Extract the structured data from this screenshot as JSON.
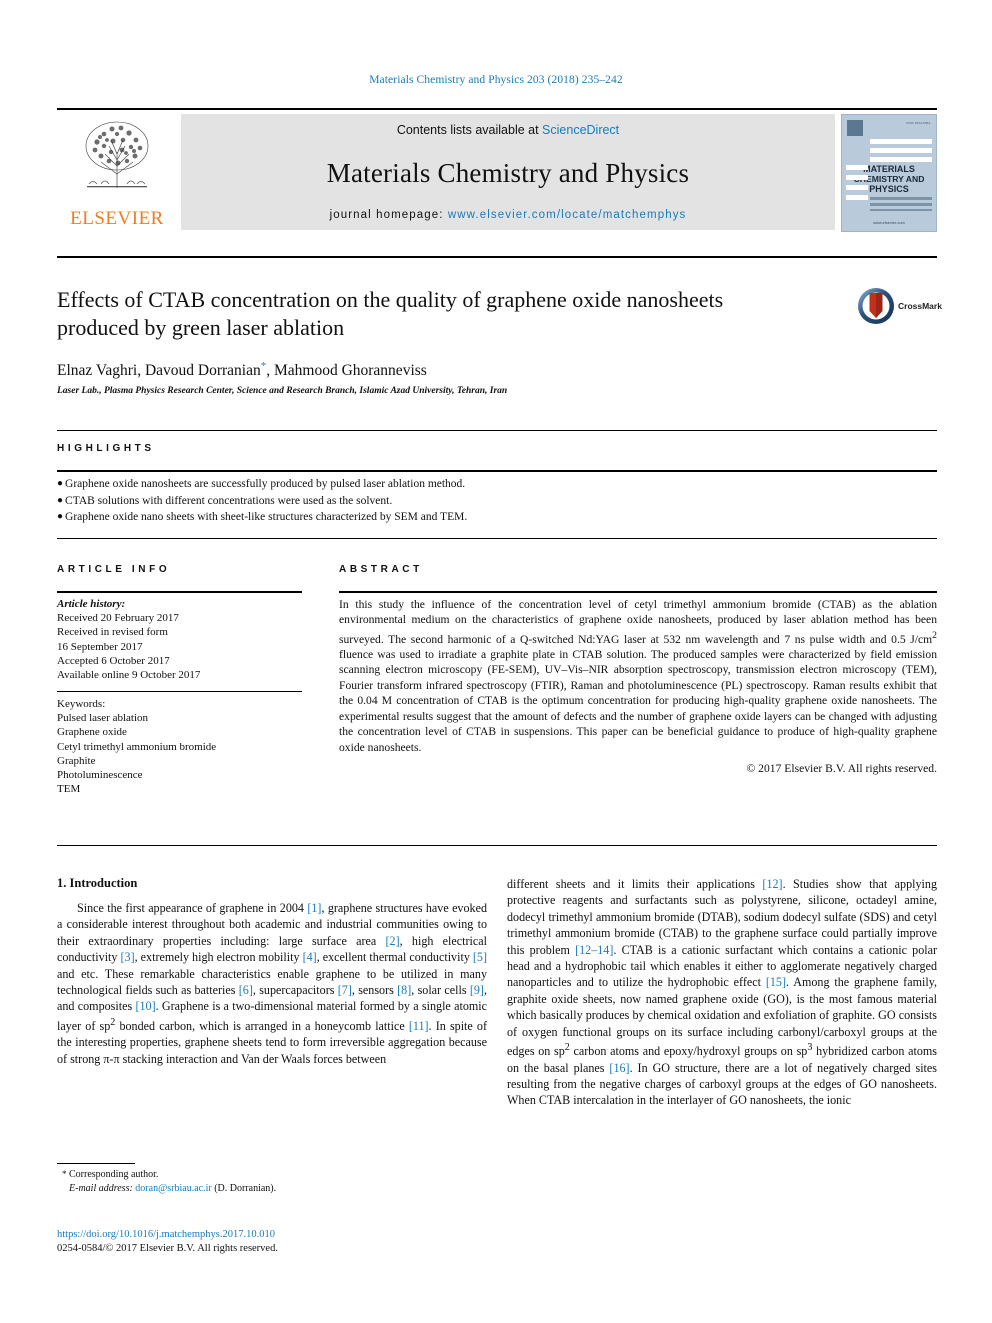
{
  "running_head": "Materials Chemistry and Physics 203 (2018) 235–242",
  "masthead": {
    "publisher_name": "ELSEVIER",
    "contents_prefix": "Contents lists available at ",
    "contents_link": "ScienceDirect",
    "journal_title": "Materials Chemistry and Physics",
    "homepage_prefix": "journal homepage: ",
    "homepage_url": "www.elsevier.com/locate/matchemphys",
    "cover": {
      "line1": "MATERIALS",
      "line2": "CHEMISTRY AND",
      "line3": "PHYSICS",
      "sub1": "MATERIALS",
      "sub2": "SCIENCE AND",
      "sub3": "ENGINEERING"
    },
    "link_color": "#1a7bb9",
    "band_color": "#e3e3e3"
  },
  "article": {
    "title": "Effects of CTAB concentration on the quality of graphene oxide nanosheets produced by green laser ablation",
    "crossmark_label": "CrossMark",
    "authors": "Elnaz Vaghri, Davoud Dorranian",
    "authors_tail": ", Mahmood Ghoranneviss",
    "corresponding_marker": "*",
    "affiliation": "Laser Lab., Plasma Physics Research Center, Science and Research Branch, Islamic Azad University, Tehran, Iran"
  },
  "highlights": {
    "heading": "HIGHLIGHTS",
    "items": [
      "Graphene oxide nanosheets are successfully produced by pulsed laser ablation method.",
      "CTAB solutions with different concentrations were used as the solvent.",
      "Graphene oxide nano sheets with sheet-like structures characterized by SEM and TEM."
    ]
  },
  "article_info": {
    "heading": "ARTICLE INFO",
    "history_label": "Article history:",
    "history": [
      "Received 20 February 2017",
      "Received in revised form",
      "16 September 2017",
      "Accepted 6 October 2017",
      "Available online 9 October 2017"
    ],
    "keywords_label": "Keywords:",
    "keywords": [
      "Pulsed laser ablation",
      "Graphene oxide",
      "Cetyl trimethyl ammonium bromide",
      "Graphite",
      "Photoluminescence",
      "TEM"
    ]
  },
  "abstract": {
    "heading": "ABSTRACT",
    "part1": "In this study the influence of the concentration level of cetyl trimethyl ammonium bromide (CTAB) as the ablation environmental medium on the characteristics of graphene oxide nanosheets, produced by laser ablation method has been surveyed. The second harmonic of a Q-switched Nd:YAG laser at 532 nm wavelength and 7 ns pulse width and 0.5 J/cm",
    "sup1": "2",
    "part2": " fluence was used to irradiate a graphite plate in CTAB solution. The produced samples were characterized by field emission scanning electron microscopy (FE-SEM), UV–Vis–NIR absorption spectroscopy, transmission electron microscopy (TEM), Fourier transform infrared spectroscopy (FTIR), Raman and photoluminescence (PL) spectroscopy. Raman results exhibit that the 0.04 M concentration of CTAB is the optimum concentration for producing high-quality graphene oxide nanosheets. The experimental results suggest that the amount of defects and the number of graphene oxide layers can be changed with adjusting the concentration level of CTAB in suspensions. This paper can be beneficial guidance to produce of high-quality graphene oxide nanosheets.",
    "copyright": "© 2017 Elsevier B.V. All rights reserved."
  },
  "body": {
    "section_number_title": "1. Introduction",
    "left_p1_a": "Since the first appearance of graphene in 2004 ",
    "left_refs": {
      "r1": "[1]",
      "r2": "[2]",
      "r3": "[3]",
      "r4": "[4]",
      "r5": "[5]",
      "r6": "[6]",
      "r7": "[7]",
      "r8": "[8]",
      "r9": "[9]",
      "r10": "[10]",
      "r11": "[11]"
    },
    "left_t1": ", graphene structures have evoked a considerable interest throughout both academic and industrial communities owing to their extraordinary properties including: large surface area ",
    "left_t2": ", high electrical conductivity ",
    "left_t3": ", extremely high electron mobility ",
    "left_t4": ", excellent thermal conductivity ",
    "left_t5": " and etc. These remarkable characteristics enable graphene to be utilized in many technological fields such as batteries ",
    "left_t6": ", supercapacitors ",
    "left_t7": ", sensors ",
    "left_t8": ", solar cells ",
    "left_t9": ", and composites ",
    "left_t10": ". Graphene is a two-dimensional material formed by a single atomic layer of sp",
    "left_sup2": "2",
    "left_t11": " bonded carbon, which is arranged in a honeycomb lattice ",
    "left_t12": ". In spite of the interesting properties, graphene sheets tend to form irreversible aggregation because of strong π-π stacking interaction and Van der Waals forces between",
    "right_refs": {
      "r12": "[12]",
      "r12_14": "[12–14]",
      "r15": "[15]",
      "r16": "[16]"
    },
    "right_t0": "different sheets and it limits their applications ",
    "right_t1": ". Studies show that applying protective reagents and surfactants such as polystyrene, silicone, octadeyl amine, dodecyl trimethyl ammonium bromide (DTAB), sodium dodecyl sulfate (SDS) and cetyl trimethyl ammonium bromide (CTAB) to the graphene surface could partially improve this problem ",
    "right_t2": ". CTAB is a cationic surfactant which contains a cationic polar head and a hydrophobic tail which enables it either to agglomerate negatively charged nanoparticles and to utilize the hydrophobic effect ",
    "right_t3": ". Among the graphene family, graphite oxide sheets, now named graphene oxide (GO), is the most famous material which basically produces by chemical oxidation and exfoliation of graphite. GO consists of oxygen functional groups on its surface including carbonyl/carboxyl groups at the edges on sp",
    "right_sup2": "2",
    "right_t4": " carbon atoms and epoxy/hydroxyl groups on sp",
    "right_sup3": "3",
    "right_t5": " hybridized carbon atoms on the basal planes ",
    "right_t6": ". In GO structure, there are a lot of negatively charged sites resulting from the negative charges of carboxyl groups at the edges of GO nanosheets. When CTAB intercalation in the interlayer of GO nanosheets, the ionic"
  },
  "footnote": {
    "star": "*",
    "corresponding": " Corresponding author.",
    "email_label": "E-mail address:",
    "email": "doran@srbiau.ac.ir",
    "email_owner": " (D. Dorranian).",
    "doi": "https://doi.org/10.1016/j.matchemphys.2017.10.010",
    "issn_line": "0254-0584/© 2017 Elsevier B.V. All rights reserved."
  }
}
